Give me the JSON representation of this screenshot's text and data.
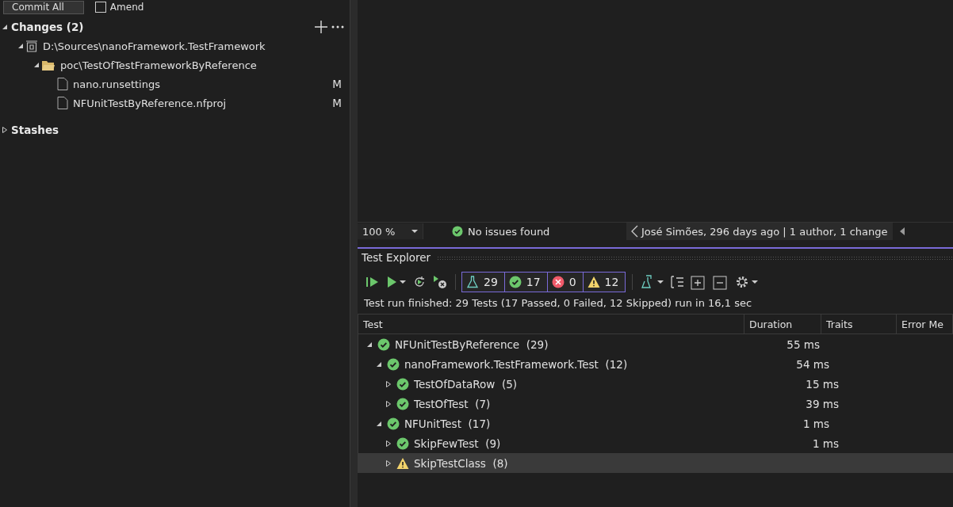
{
  "commit_bar": {
    "commit_button": "Commit All",
    "amend": {
      "label": "Amend",
      "checked": false
    }
  },
  "changes": {
    "title": "Changes (2)",
    "expanded": true,
    "tree": [
      {
        "label": "D:\\Sources\\nanoFramework.TestFramework",
        "kind": "repo",
        "expanded": true,
        "children": [
          {
            "label": "poc\\TestOfTestFrameworkByReference",
            "kind": "folder",
            "expanded": true,
            "children": [
              {
                "label": "nano.runsettings",
                "kind": "file",
                "status": "M"
              },
              {
                "label": "NFUnitTestByReference.nfproj",
                "kind": "file",
                "status": "M"
              }
            ]
          }
        ]
      }
    ]
  },
  "stashes": {
    "title": "Stashes",
    "expanded": false
  },
  "editor_status": {
    "zoom": "100 %",
    "issues": "No issues found",
    "blame": "José Simões, 296 days ago | 1 author, 1 change"
  },
  "test_explorer": {
    "title": "Test Explorer",
    "counters": [
      {
        "kind": "total",
        "value": "29"
      },
      {
        "kind": "passed",
        "value": "17"
      },
      {
        "kind": "failed",
        "value": "0"
      },
      {
        "kind": "skipped",
        "value": "12"
      }
    ],
    "summary": "Test run finished: 29 Tests (17 Passed, 0 Failed, 12 Skipped) run in 16,1 sec",
    "columns": [
      "Test",
      "Duration",
      "Traits",
      "Error Me"
    ],
    "rows": [
      {
        "name": "NFUnitTestByReference",
        "count": "(29)",
        "kind": "passed",
        "duration": "55 ms",
        "expanded": true,
        "selected": false,
        "children": [
          {
            "name": "nanoFramework.TestFramework.Test",
            "count": "(12)",
            "kind": "passed",
            "duration": "54 ms",
            "expanded": true,
            "selected": false,
            "children": [
              {
                "name": "TestOfDataRow",
                "count": "(5)",
                "kind": "passed",
                "duration": "15 ms",
                "expanded": false,
                "selected": false
              },
              {
                "name": "TestOfTest",
                "count": "(7)",
                "kind": "passed",
                "duration": "39 ms",
                "expanded": false,
                "selected": false
              }
            ]
          },
          {
            "name": "NFUnitTest",
            "count": "(17)",
            "kind": "passed",
            "duration": "1 ms",
            "expanded": true,
            "selected": false,
            "children": [
              {
                "name": "SkipFewTest",
                "count": "(9)",
                "kind": "passed",
                "duration": "1 ms",
                "expanded": false,
                "selected": false
              },
              {
                "name": "SkipTestClass",
                "count": "(8)",
                "kind": "skipped",
                "expanded": false,
                "selected": true
              }
            ]
          }
        ]
      }
    ]
  }
}
